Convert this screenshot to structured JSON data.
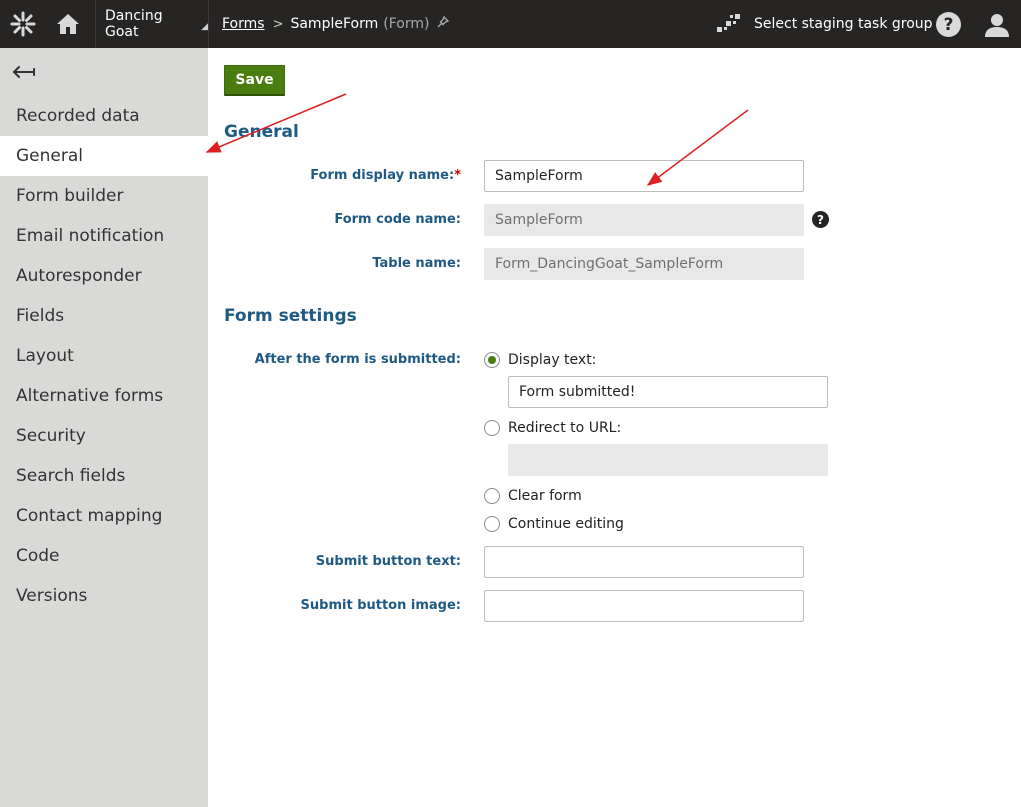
{
  "topbar": {
    "logo_icon": "kentico-logo-icon",
    "home_icon": "home-icon",
    "site_name": "Dancing Goat",
    "breadcrumb": {
      "root": "Forms",
      "current": "SampleForm",
      "type": "(Form)"
    },
    "staging_label": "Select staging task group",
    "help_glyph": "?"
  },
  "sidebar": {
    "items": [
      {
        "label": "Recorded data"
      },
      {
        "label": "General"
      },
      {
        "label": "Form builder"
      },
      {
        "label": "Email notification"
      },
      {
        "label": "Autoresponder"
      },
      {
        "label": "Fields"
      },
      {
        "label": "Layout"
      },
      {
        "label": "Alternative forms"
      },
      {
        "label": "Security"
      },
      {
        "label": "Search fields"
      },
      {
        "label": "Contact mapping"
      },
      {
        "label": "Code"
      },
      {
        "label": "Versions"
      }
    ],
    "active": "General"
  },
  "main": {
    "save_label": "Save",
    "general": {
      "heading": "General",
      "display_name_label": "Form display name:",
      "display_name_value": "SampleForm",
      "code_name_label": "Form code name:",
      "code_name_value": "SampleForm",
      "table_name_label": "Table name:",
      "table_name_value": "Form_DancingGoat_SampleForm"
    },
    "settings": {
      "heading": "Form settings",
      "after_submit_label": "After the form is submitted:",
      "options": {
        "display_text": "Display text:",
        "redirect": "Redirect to URL:",
        "clear": "Clear form",
        "continue": "Continue editing"
      },
      "selected_option": "Display text:",
      "display_text_value": "Form submitted!",
      "redirect_value": "",
      "submit_text_label": "Submit button text:",
      "submit_text_value": "",
      "submit_image_label": "Submit button image:",
      "submit_image_value": ""
    }
  },
  "colors": {
    "topbar": "#262524",
    "sidebar": "#d9dad8",
    "heading": "#1e5a83",
    "save_button": "#497d0f",
    "annotation_arrow": "#e02020"
  }
}
